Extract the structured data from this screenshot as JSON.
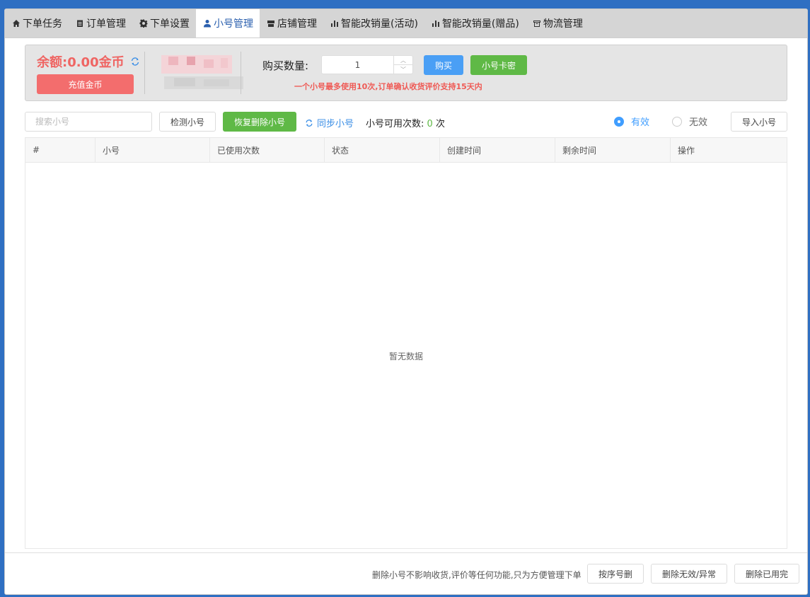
{
  "tabs": [
    {
      "label": "下单任务",
      "icon": "home-icon"
    },
    {
      "label": "订单管理",
      "icon": "clipboard-icon"
    },
    {
      "label": "下单设置",
      "icon": "gear-icon"
    },
    {
      "label": "小号管理",
      "icon": "user-icon"
    },
    {
      "label": "店铺管理",
      "icon": "store-icon"
    },
    {
      "label": "智能改销量(活动)",
      "icon": "bar-chart-icon"
    },
    {
      "label": "智能改销量(赠品)",
      "icon": "bar-chart-icon"
    },
    {
      "label": "物流管理",
      "icon": "box-icon"
    }
  ],
  "active_tab": "小号管理",
  "account": {
    "balance": "余额:0.00金币",
    "recharge_label": "充值金币"
  },
  "purchase": {
    "label": "购买数量:",
    "quantity": "1",
    "buy_label": "购买",
    "card_label": "小号卡密",
    "notice": "一个小号最多使用10次,订单确认收货评价支持15天内"
  },
  "toolbar": {
    "search_placeholder": "搜索小号",
    "check_label": "检测小号",
    "restore_label": "恢复删除小号",
    "sync_label": "同步小号",
    "avail_prefix": "小号可用次数:",
    "avail_count": "0",
    "avail_suffix": "次",
    "radio_valid": "有效",
    "radio_invalid": "无效",
    "import_label": "导入小号"
  },
  "table": {
    "columns": [
      "#",
      "小号",
      "已使用次数",
      "状态",
      "创建时间",
      "剩余时间",
      "操作"
    ],
    "empty_text": "暂无数据"
  },
  "footer": {
    "note": "删除小号不影响收货,评价等任何功能,只为方便管理下单",
    "sort_delete": "按序号删",
    "delete_invalid": "删除无效/异常",
    "delete_used": "删除已用完"
  },
  "colors": {
    "balance": "#ef6563",
    "recharge": "#f36d6d",
    "buy": "#4a9ff5",
    "green": "#5fb946",
    "link": "#3a8ee6",
    "active_tab_text": "#2a5fae"
  }
}
